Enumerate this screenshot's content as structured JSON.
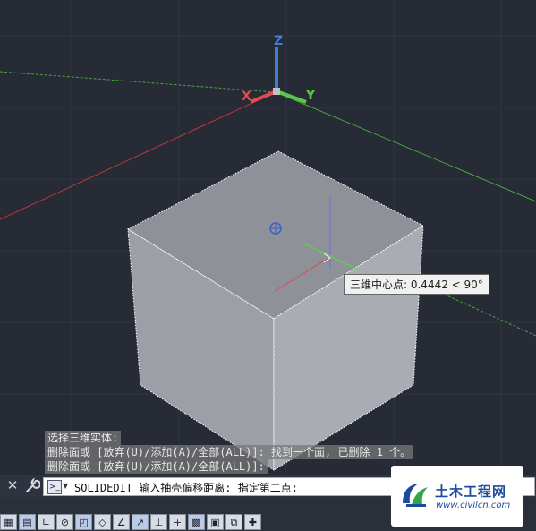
{
  "viewport": {
    "axes": {
      "z_label": "Z",
      "x_label": "X",
      "y_label": "Y"
    },
    "tooltip": "三维中心点: 0.4442 < 90°",
    "colors": {
      "background": "#262b36",
      "cube_top": "#8e9298",
      "cube_left": "#9ca0a6",
      "cube_right": "#a9adb3",
      "x_axis": "#e14b4b",
      "y_axis": "#58c94a",
      "z_axis": "#3f7fd6"
    }
  },
  "command_history": {
    "lines": [
      "选择三维实体:",
      "删除面或 [放弃(U)/添加(A)/全部(ALL)]: 找到一个面, 已删除 1 个。",
      "删除面或 [放弃(U)/添加(A)/全部(ALL)]:"
    ]
  },
  "command_line": {
    "close_icon": "close-icon",
    "text": "SOLIDEDIT 输入抽壳偏移距离:  指定第二点:"
  },
  "watermark": {
    "title": "土木工程网",
    "url": "www.civilcn.com"
  }
}
